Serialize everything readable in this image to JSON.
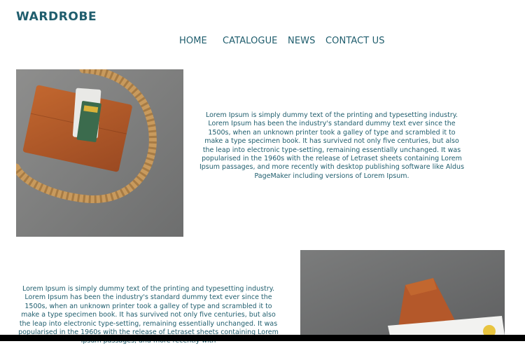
{
  "header": {
    "brand": "WARDROBE"
  },
  "nav": {
    "items": [
      {
        "label": "HOME"
      },
      {
        "label": "CATALOGUE"
      },
      {
        "label": "NEWS"
      },
      {
        "label": "CONTACT US"
      }
    ]
  },
  "sections": [
    {
      "image_icon": "wallet-rope-photo",
      "text": "Lorem Ipsum is simply dummy text of the printing and typesetting industry. Lorem Ipsum has been the industry's standard dummy text ever since the 1500s, when an unknown printer took a galley of type and scrambled it to make a type specimen book. It has survived not only five centuries, but also the leap into electronic type-setting, remaining essentially unchanged. It was popularised in the 1960s with the release of Letraset sheets containing Lorem Ipsum passages, and more recently with desktop publishing software like Aldus PageMaker including versions of Lorem Ipsum."
    },
    {
      "image_icon": "leather-folio-photo",
      "text": "Lorem Ipsum is simply dummy text of the printing and typesetting industry. Lorem Ipsum has been the industry's standard dummy text ever since the 1500s, when an unknown printer took a galley of type and scrambled it to make a type specimen book. It has survived not only five centuries, but also the leap into electronic type-setting, remaining essentially unchanged. It was popularised in the 1960s with the release of Letraset sheets containing Lorem Ipsum passages, and more recently with"
    }
  ],
  "colors": {
    "accent": "#1f5d6d",
    "photo_background": "#7d7e7e",
    "leather": "#b45a2c",
    "rope": "#c99a5a"
  }
}
